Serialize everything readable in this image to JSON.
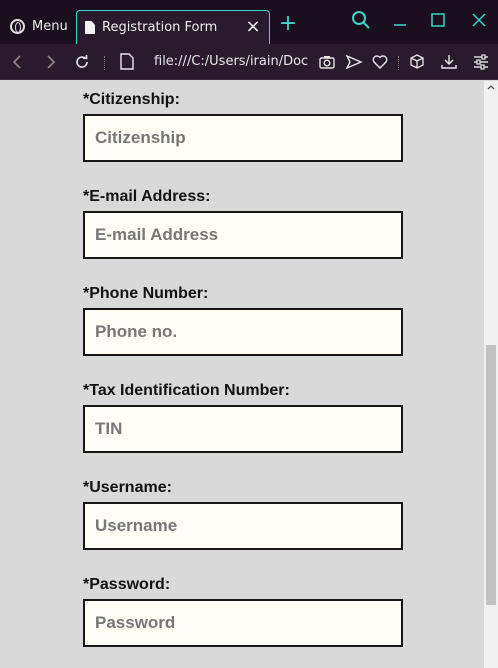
{
  "browser": {
    "menu_label": "Menu",
    "tab_title": "Registration Form",
    "url": "file:///C:/Users/irain/Documents/",
    "accent_color": "#3fd4c8"
  },
  "form": {
    "fields": [
      {
        "label": "*Citizenship:",
        "placeholder": "Citizenship"
      },
      {
        "label": "*E-mail Address:",
        "placeholder": "E-mail Address"
      },
      {
        "label": "*Phone Number:",
        "placeholder": "Phone no."
      },
      {
        "label": "*Tax Identification Number:",
        "placeholder": "TIN"
      },
      {
        "label": "*Username:",
        "placeholder": "Username"
      },
      {
        "label": "*Password:",
        "placeholder": "Password"
      }
    ]
  }
}
